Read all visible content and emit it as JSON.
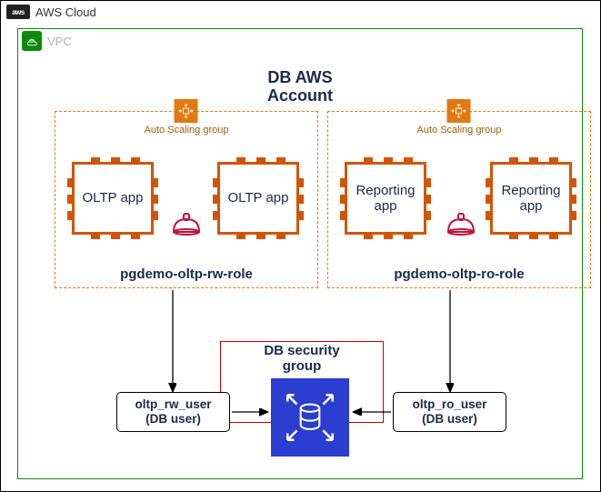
{
  "cloud": {
    "label": "AWS Cloud"
  },
  "vpc": {
    "label": "VPC"
  },
  "account_title_line1": "DB AWS",
  "account_title_line2": "Account",
  "asg": {
    "label": "Auto Scaling group"
  },
  "apps": {
    "oltp": "OLTP app",
    "reporting": "Reporting app"
  },
  "roles": {
    "rw": "pgdemo-oltp-rw-role",
    "ro": "pgdemo-oltp-ro-role"
  },
  "db_sg": {
    "title_line1": "DB security",
    "title_line2": "group"
  },
  "db_users": {
    "rw_line1": "oltp_rw_user",
    "rw_line2": "(DB user)",
    "ro_line1": "oltp_ro_user",
    "ro_line2": "(DB user)"
  }
}
